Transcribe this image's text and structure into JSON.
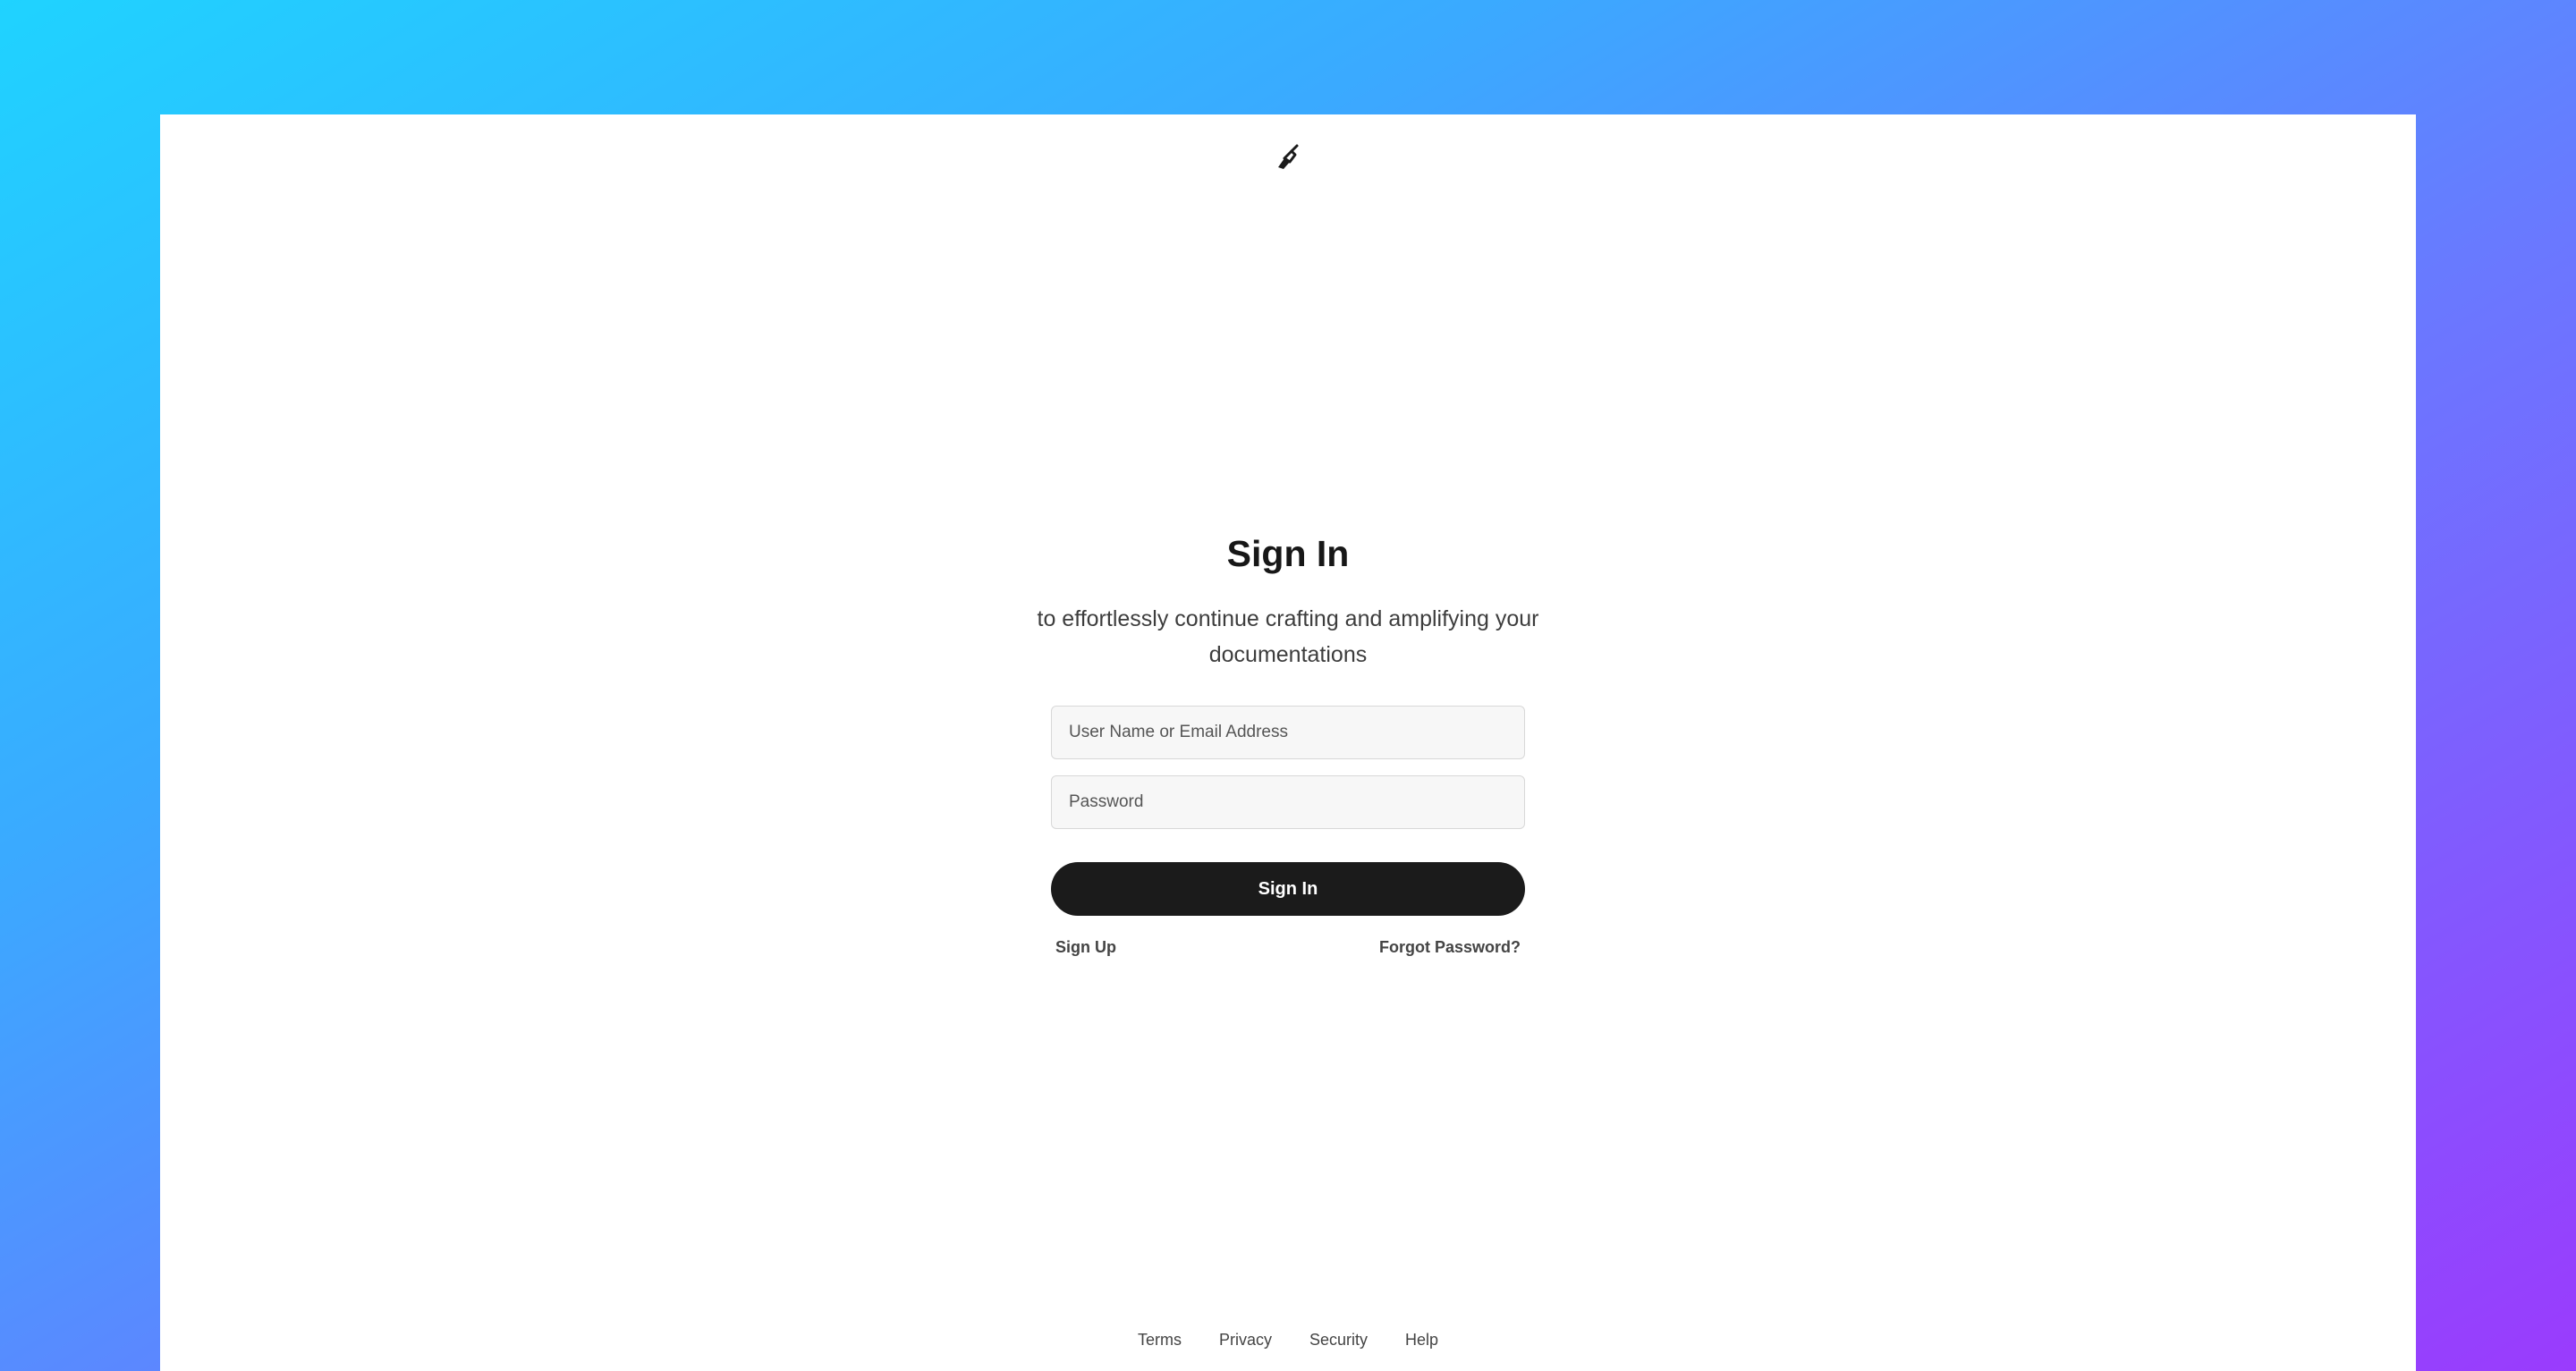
{
  "brand": {
    "logo_icon": "pen-nib-icon"
  },
  "signin": {
    "title": "Sign In",
    "subtitle": "to effortlessly continue crafting and amplifying your documentations",
    "username_placeholder": "User Name or Email Address",
    "username_value": "",
    "password_placeholder": "Password",
    "password_value": "",
    "button_label": "Sign In",
    "signup_link": "Sign Up",
    "forgot_link": "Forgot Password?"
  },
  "footer": {
    "links": [
      "Terms",
      "Privacy",
      "Security",
      "Help"
    ]
  },
  "colors": {
    "button_bg": "#1b1b1b",
    "gradient_start": "#1fd3ff",
    "gradient_end": "#9a3bfd"
  }
}
